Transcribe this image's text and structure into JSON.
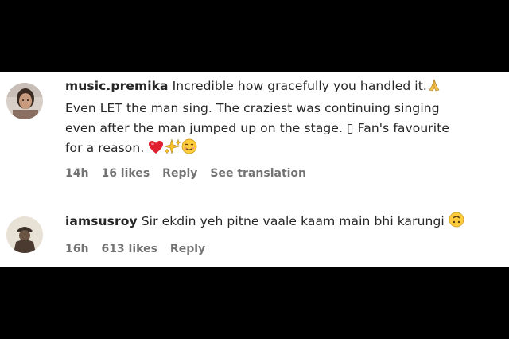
{
  "comments": [
    {
      "username": "music.premika",
      "text_line1": "Incredible how gracefully you handled it.",
      "text_line2": "Even LET the man sing. The craziest was continuing singing",
      "text_line3": "even after the man jumped up on the stage. ▯ Fan's favourite",
      "text_line4": "for a reason.",
      "time": "14h",
      "likes": "16 likes",
      "reply": "Reply",
      "see_translation": "See translation"
    },
    {
      "username": "iamsusroy",
      "text": "Sir ekdin yeh pitne vaale kaam main bhi karungi",
      "time": "16h",
      "likes": "613 likes",
      "reply": "Reply"
    }
  ],
  "icons": {
    "pray": "pray-emoji",
    "heart": "red-heart-emoji",
    "sparkles": "sparkles-emoji",
    "smile": "smiling-face-emoji",
    "upside_down": "upside-down-face-emoji"
  },
  "colors": {
    "text": "#262626",
    "meta": "#737373",
    "letterbox": "#000000",
    "panel": "#ffffff"
  }
}
